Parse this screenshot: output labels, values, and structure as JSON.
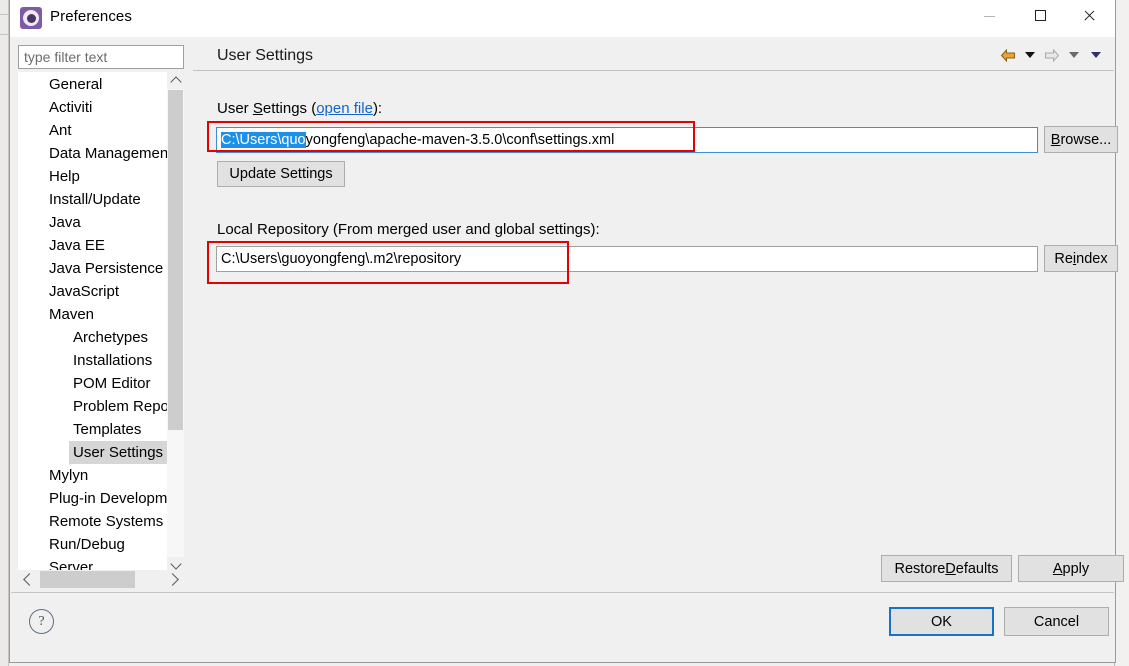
{
  "window": {
    "title": "Preferences",
    "icon": "preferences-gear-icon",
    "controls": {
      "minimize": "minimize-icon",
      "maximize": "maximize-icon",
      "close": "close-icon"
    }
  },
  "sidebar": {
    "filter": {
      "placeholder": "type filter text",
      "value": ""
    },
    "items": [
      {
        "label": "General",
        "level": 0,
        "selected": false
      },
      {
        "label": "Activiti",
        "level": 0,
        "selected": false
      },
      {
        "label": "Ant",
        "level": 0,
        "selected": false
      },
      {
        "label": "Data Management",
        "level": 0,
        "selected": false
      },
      {
        "label": "Help",
        "level": 0,
        "selected": false
      },
      {
        "label": "Install/Update",
        "level": 0,
        "selected": false
      },
      {
        "label": "Java",
        "level": 0,
        "selected": false
      },
      {
        "label": "Java EE",
        "level": 0,
        "selected": false
      },
      {
        "label": "Java Persistence",
        "level": 0,
        "selected": false
      },
      {
        "label": "JavaScript",
        "level": 0,
        "selected": false
      },
      {
        "label": "Maven",
        "level": 0,
        "selected": false
      },
      {
        "label": "Archetypes",
        "level": 1,
        "selected": false
      },
      {
        "label": "Installations",
        "level": 1,
        "selected": false
      },
      {
        "label": "POM Editor",
        "level": 1,
        "selected": false
      },
      {
        "label": "Problem Reporting",
        "level": 1,
        "selected": false
      },
      {
        "label": "Templates",
        "level": 1,
        "selected": false
      },
      {
        "label": "User Settings",
        "level": 1,
        "selected": true
      },
      {
        "label": "Mylyn",
        "level": 0,
        "selected": false
      },
      {
        "label": "Plug-in Development",
        "level": 0,
        "selected": false
      },
      {
        "label": "Remote Systems",
        "level": 0,
        "selected": false
      },
      {
        "label": "Run/Debug",
        "level": 0,
        "selected": false
      },
      {
        "label": "Server",
        "level": 0,
        "selected": false
      }
    ],
    "scroll": {
      "up_icon": "chevron-up-icon",
      "down_icon": "chevron-down-icon",
      "left_icon": "chevron-left-icon",
      "right_icon": "chevron-right-icon"
    }
  },
  "content": {
    "title": "User Settings",
    "nav": {
      "back_icon": "back-arrow-icon",
      "back_menu_icon": "caret-down-icon",
      "forward_icon": "forward-arrow-icon",
      "forward_menu_icon": "caret-down-icon",
      "view_menu_icon": "caret-down-icon"
    },
    "user_settings": {
      "label_prefix": "User ",
      "label_mnemonic": "S",
      "label_suffix": "ettings (",
      "link": "open file",
      "label_end": "):",
      "field_selected_text": "C:\\Users\\quo",
      "field_rest_text": "yongfeng\\apache-maven-3.5.0\\conf\\settings.xml",
      "field_full_value": "C:\\Users\\quoyongfeng\\apache-maven-3.5.0\\conf\\settings.xml",
      "browse_button": "Browse...",
      "browse_mnemonic": "B",
      "update_button": "Update Settings"
    },
    "local_repository": {
      "label": "Local Repository (From merged user and global settings):",
      "field_value": "C:\\Users\\guoyongfeng\\.m2\\repository",
      "reindex_button_prefix": "Re",
      "reindex_button_mnemonic": "i",
      "reindex_button_suffix": "ndex"
    },
    "buttons": {
      "restore_prefix": "Restore ",
      "restore_mnemonic": "D",
      "restore_suffix": "efaults",
      "apply_mnemonic": "A",
      "apply_suffix": "pply"
    }
  },
  "footer": {
    "help_icon": "help-question-icon",
    "help_glyph": "?",
    "ok_button": "OK",
    "cancel_button": "Cancel"
  },
  "annotations": [
    {
      "name": "user-settings-field-highlight",
      "color": "#e60000"
    },
    {
      "name": "local-repository-field-highlight",
      "color": "#e60000"
    }
  ],
  "colors": {
    "accent_blue": "#1673c8",
    "selection_blue": "#1e90e8",
    "link_blue": "#1265cc",
    "annotation_red": "#e60000",
    "dialog_bg": "#f0f0f0"
  }
}
